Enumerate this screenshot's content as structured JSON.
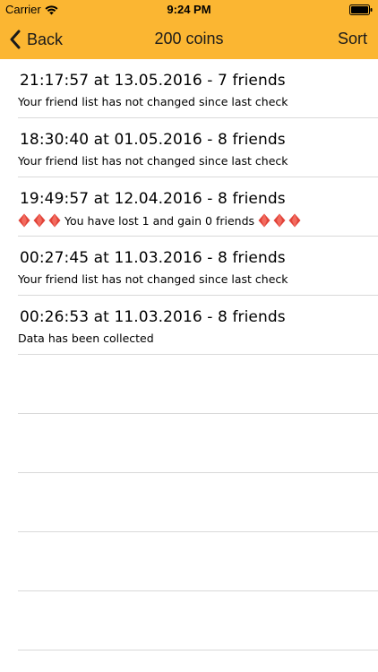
{
  "status_bar": {
    "carrier": "Carrier",
    "time": "9:24 PM"
  },
  "navbar": {
    "back_label": "Back",
    "title": "200 coins",
    "sort_label": "Sort",
    "bar_color": "#fbb632"
  },
  "entries": [
    {
      "title": "21:17:57 at 13.05.2016 - 7 friends",
      "detail": "Your friend list has not changed since last check",
      "diamonds": false
    },
    {
      "title": "18:30:40 at 01.05.2016 - 8 friends",
      "detail": "Your friend list has not changed since last check",
      "diamonds": false
    },
    {
      "title": "19:49:57 at 12.04.2016 - 8 friends",
      "detail": "You have lost 1 and gain 0 friends",
      "diamonds": true
    },
    {
      "title": "00:27:45 at 11.03.2016 - 8 friends",
      "detail": "Your friend list has not changed since last check",
      "diamonds": false
    },
    {
      "title": "00:26:53 at 11.03.2016 - 8 friends",
      "detail": "Data has been collected",
      "diamonds": false
    }
  ],
  "icons": {
    "wifi": "wifi-icon",
    "battery": "battery-icon",
    "back": "chevron-left-icon",
    "diamond": "red-diamond-icon"
  }
}
